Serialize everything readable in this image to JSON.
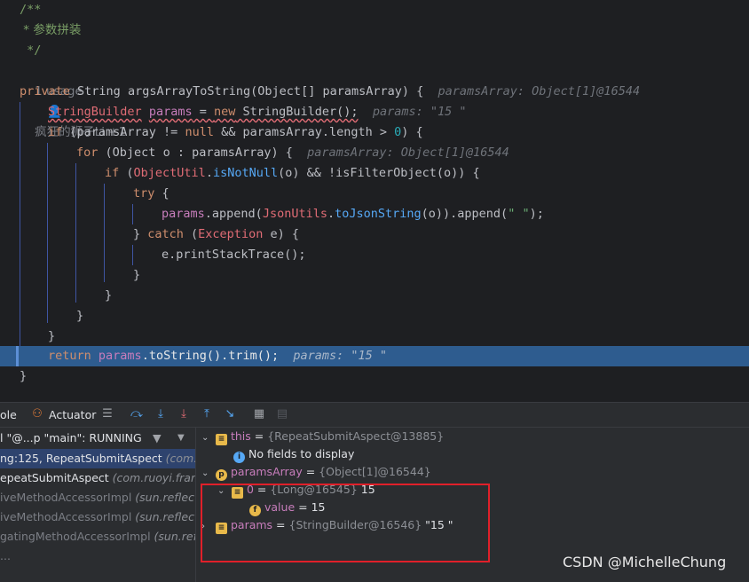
{
  "code": {
    "comment": {
      "open": "/**",
      "body": " * 参数拼装",
      "close": " */"
    },
    "usage": {
      "count": "1 usage",
      "author": "疯狂的狮子Li +1"
    },
    "sig": {
      "private": "private",
      "type": "String",
      "name": "argsArrayToString",
      "p1": "(",
      "ptype": "Object",
      "p2": "[] paramsArray) {",
      "hint": "paramsArray: Object[1]@16544"
    },
    "l1": {
      "type": "StringBuilder",
      "var": "params",
      "eq": " = ",
      "new": "new",
      "ctor": " StringBuilder();",
      "hint": "params: \"15 \""
    },
    "l2": {
      "if": "if",
      "rest": " (paramsArray != ",
      "null": "null",
      "and": " && paramsArray.length > ",
      "zero": "0",
      "end": ") {"
    },
    "l3": {
      "for": "for",
      "p": " (",
      "obj": "Object",
      "rest": " o : paramsArray) {",
      "hint": "paramsArray: Object[1]@16544"
    },
    "l4": {
      "if": "if",
      "p": " (",
      "cls": "ObjectUtil",
      "dot": ".",
      "fn": "isNotNull",
      "rest": "(o) && !isFilterObject(o)) {"
    },
    "l5": {
      "try": "try",
      "rest": " {"
    },
    "l6": {
      "var": "params",
      "d1": ".append(",
      "cls": "JsonUtils",
      "d2": ".",
      "fn": "toJsonString",
      "d3": "(o)).append(",
      "str": "\" \"",
      "end": ");"
    },
    "l7": {
      "close": "} ",
      "catch": "catch",
      "p": " (",
      "ex": "Exception",
      "rest": " e) {"
    },
    "l8": {
      "text": "e.printStackTrace();"
    },
    "brace": "}",
    "ret": {
      "kw": "return",
      "var": " params",
      "rest": ".toString().trim();",
      "hint": "params: \"15 \""
    }
  },
  "toolbar": {
    "console": "ole",
    "actuator": "Actuator"
  },
  "thread": {
    "label": "l \"@...p \"main\": RUNNING"
  },
  "frames": [
    {
      "method": "ng:125, RepeatSubmitAspect",
      "pkg": " (com.r",
      "selected": true
    },
    {
      "method": "epeatSubmitAspect",
      "pkg": " (com.ruoyi.fram",
      "selected": false
    },
    {
      "method": "iveMethodAccessorImpl",
      "pkg": " (sun.reflec",
      "selected": false
    },
    {
      "method": "iveMethodAccessorImpl",
      "pkg": " (sun.reflect)",
      "selected": false
    },
    {
      "method": "gatingMethodAccessorImpl",
      "pkg": " (sun.ref",
      "selected": false
    },
    {
      "method": "...",
      "pkg": "",
      "selected": false
    }
  ],
  "variables": {
    "this": {
      "name": "this",
      "eq": " = ",
      "type": "{RepeatSubmitAspect@13885}"
    },
    "nofields": "No fields to display",
    "paramsArray": {
      "name": "paramsArray",
      "eq": " = ",
      "type": "{Object[1]@16544}"
    },
    "zero": {
      "name": "0",
      "eq": " = ",
      "type": "{Long@16545}",
      "val": " 15"
    },
    "value": {
      "name": "value",
      "eq": " = ",
      "val": "15"
    },
    "params": {
      "name": "params",
      "eq": " = ",
      "type": "{StringBuilder@16546}",
      "val": " \"15 \""
    }
  },
  "watermark": "CSDN @MichelleChung",
  "colors": {
    "accent": "#2e5c8f",
    "highlight_box": "#e0202a"
  }
}
